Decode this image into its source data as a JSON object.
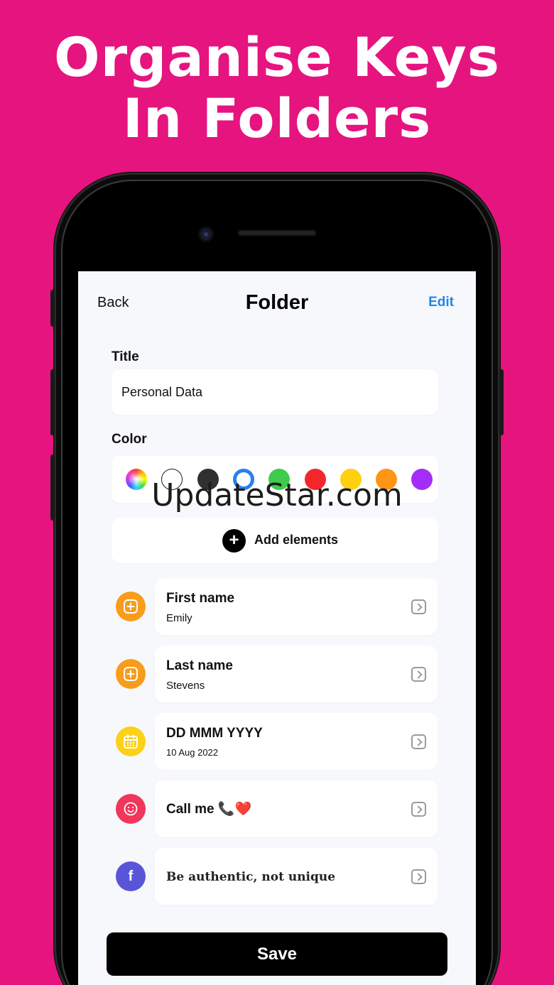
{
  "headline": {
    "line1": "Organise Keys",
    "line2": "In Folders"
  },
  "nav": {
    "back": "Back",
    "title": "Folder",
    "edit": "Edit"
  },
  "form": {
    "title_label": "Title",
    "title_value": "Personal Data",
    "color_label": "Color",
    "colors": [
      "rainbow",
      "#ffffff",
      "#2f3033",
      "#2a7ff0",
      "#3fcb4b",
      "#f2262b",
      "#fed00e",
      "#ff9514",
      "#a42dfa"
    ],
    "selected_color": "#2a7ff0",
    "add_elements": "Add elements",
    "add_icon": "+"
  },
  "watermark": "UpdateStar.com",
  "items": [
    {
      "title": "First name",
      "subtitle": "Emily",
      "icon": "plus-square-icon",
      "color": "#f79d1b"
    },
    {
      "title": "Last name",
      "subtitle": "Stevens",
      "icon": "plus-square-icon",
      "color": "#f79d1b"
    },
    {
      "title": "DD MMM YYYY",
      "subtitle": "10 Aug 2022",
      "icon": "calendar-icon",
      "color": "#fcd116"
    },
    {
      "title": "Call me 📞❤️",
      "icon": "smile-icon",
      "color": "#f0365a"
    },
    {
      "title": "𝐁𝐞 𝐚𝐮𝐭𝐡𝐞𝐧𝐭𝐢𝐜, 𝐧𝐨𝐭 𝐮𝐧𝐢𝐪𝐮𝐞",
      "icon": "facebook-icon",
      "color": "#5a55d8"
    }
  ],
  "save": "Save"
}
